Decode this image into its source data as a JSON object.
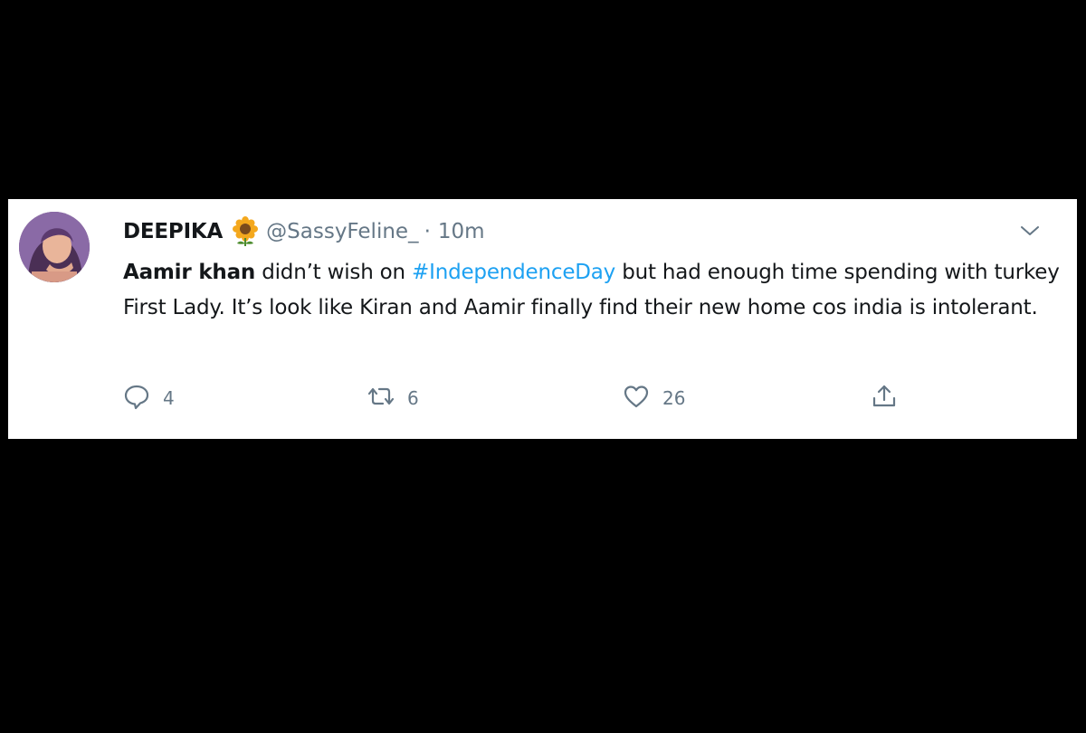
{
  "tweet": {
    "display_name": "DEEPIKA",
    "handle": "@SassyFeline_",
    "separator": "·",
    "time": "10m",
    "text_bold": "Aamir khan",
    "text_part1": " didn’t wish on ",
    "hashtag": "#IndependenceDay",
    "text_part2": " but had enough time spending with turkey First Lady. It’s look like Kiran and Aamir finally find their new home cos india is intolerant.",
    "reply_count": "4",
    "retweet_count": "6",
    "like_count": "26"
  },
  "colors": {
    "background": "#000000",
    "card": "#ffffff",
    "hashtag": "#1da1f2",
    "secondary_text": "#657786",
    "primary_text": "#14171a"
  },
  "icons": {
    "badge": "sunflower-icon",
    "menu": "chevron-down-icon",
    "reply": "reply-icon",
    "retweet": "retweet-icon",
    "like": "heart-icon",
    "share": "share-icon"
  }
}
